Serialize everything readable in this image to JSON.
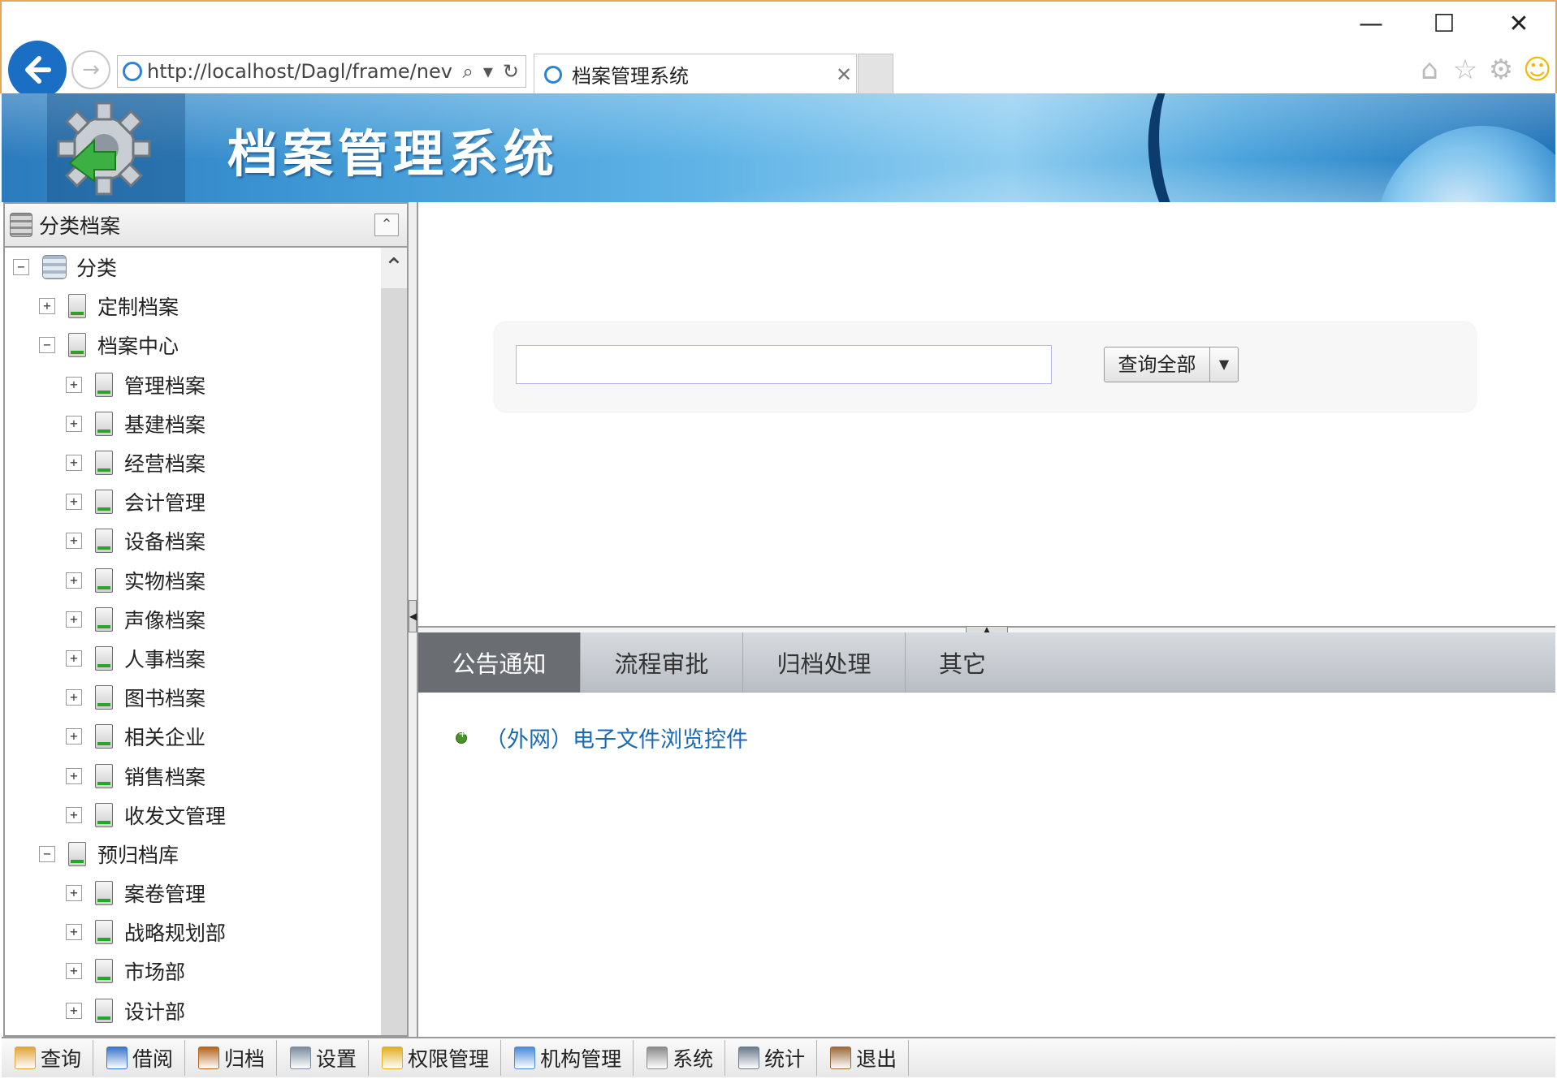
{
  "browser": {
    "url": "http://localhost/Dagl/frame/nev",
    "tab_title": "档案管理系统",
    "window_controls": {
      "minimize": "—",
      "maximize": "☐",
      "close": "✕"
    }
  },
  "banner": {
    "title": "档案管理系统"
  },
  "left_panel": {
    "title": "分类档案",
    "tree": [
      {
        "label": "分类",
        "toggle": "−",
        "level": 0
      },
      {
        "label": "定制档案",
        "toggle": "+",
        "level": 1
      },
      {
        "label": "档案中心",
        "toggle": "−",
        "level": 1
      },
      {
        "label": "管理档案",
        "toggle": "+",
        "level": 2
      },
      {
        "label": "基建档案",
        "toggle": "+",
        "level": 2
      },
      {
        "label": "经营档案",
        "toggle": "+",
        "level": 2
      },
      {
        "label": "会计管理",
        "toggle": "+",
        "level": 2
      },
      {
        "label": "设备档案",
        "toggle": "+",
        "level": 2
      },
      {
        "label": "实物档案",
        "toggle": "+",
        "level": 2
      },
      {
        "label": "声像档案",
        "toggle": "+",
        "level": 2
      },
      {
        "label": "人事档案",
        "toggle": "+",
        "level": 2
      },
      {
        "label": "图书档案",
        "toggle": "+",
        "level": 2
      },
      {
        "label": "相关企业",
        "toggle": "+",
        "level": 2
      },
      {
        "label": "销售档案",
        "toggle": "+",
        "level": 2
      },
      {
        "label": "收发文管理",
        "toggle": "+",
        "level": 2
      },
      {
        "label": "预归档库",
        "toggle": "−",
        "level": 1
      },
      {
        "label": "案卷管理",
        "toggle": "+",
        "level": 2
      },
      {
        "label": "战略规划部",
        "toggle": "+",
        "level": 2
      },
      {
        "label": "市场部",
        "toggle": "+",
        "level": 2
      },
      {
        "label": "设计部",
        "toggle": "+",
        "level": 2
      }
    ]
  },
  "search": {
    "value": "",
    "button_label": "查询全部"
  },
  "tabs": [
    {
      "label": "公告通知",
      "active": true
    },
    {
      "label": "流程审批",
      "active": false
    },
    {
      "label": "归档处理",
      "active": false
    },
    {
      "label": "其它",
      "active": false
    }
  ],
  "notices": [
    {
      "text": "（外网）电子文件浏览控件"
    }
  ],
  "bottom_toolbar": [
    {
      "label": "查询",
      "icon": "edit-icon",
      "color": "#e0a43a"
    },
    {
      "label": "借阅",
      "icon": "tag-icon",
      "color": "#3a74c9"
    },
    {
      "label": "归档",
      "icon": "cabinet-icon",
      "color": "#b5651d"
    },
    {
      "label": "设置",
      "icon": "wrench-icon",
      "color": "#7a8ca0"
    },
    {
      "label": "权限管理",
      "icon": "lock-icon",
      "color": "#e0b020"
    },
    {
      "label": "机构管理",
      "icon": "users-icon",
      "color": "#4a8ad6"
    },
    {
      "label": "系统",
      "icon": "gear-icon",
      "color": "#8a8a8a"
    },
    {
      "label": "统计",
      "icon": "calculator-icon",
      "color": "#6a7a8a"
    },
    {
      "label": "退出",
      "icon": "exit-door-icon",
      "color": "#9c6b3a"
    }
  ]
}
